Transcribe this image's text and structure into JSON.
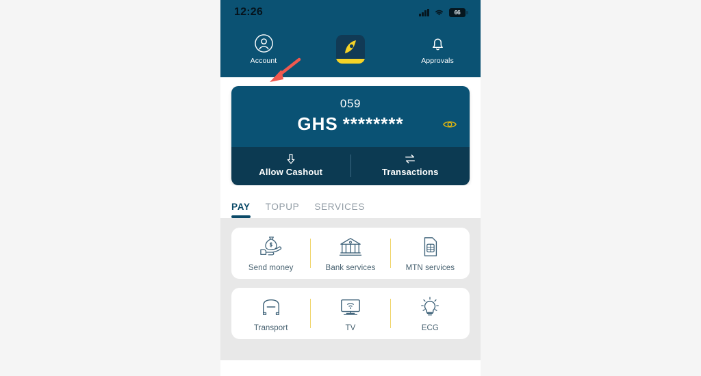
{
  "colors": {
    "header_bg": "#0b5273",
    "card_top": "#0a5274",
    "card_bottom": "#0c3a52",
    "accent_yellow": "#f5d327",
    "divider_yellow": "#f0d469",
    "active_tab": "#0b4a68",
    "inactive_tab": "#8f9aa3",
    "services_bg": "#e8e8e8",
    "annotation_arrow": "#f0594f",
    "page_bg": "#f5f5f5"
  },
  "statusbar": {
    "time": "12:26",
    "signal_icon": "cellular-signal-icon",
    "wifi_icon": "wifi-icon",
    "battery_level": "66",
    "battery_icon": "battery-icon"
  },
  "header": {
    "account": {
      "label": "Account",
      "icon": "user-circle-icon"
    },
    "logo": {
      "icon": "app-logo-icon"
    },
    "approvals": {
      "label": "Approvals",
      "icon": "bell-icon"
    }
  },
  "annotation": {
    "arrow_icon": "red-arrow-annotation",
    "points_at": "Account"
  },
  "balance_card": {
    "account_number": "059",
    "currency": "GHS",
    "masked_amount": "********",
    "toggle_visibility_icon": "eye-icon",
    "actions": [
      {
        "label": "Allow Cashout",
        "icon": "arrow-down-icon"
      },
      {
        "label": "Transactions",
        "icon": "transfer-arrows-icon"
      }
    ]
  },
  "tabs": [
    {
      "label": "PAY",
      "active": true
    },
    {
      "label": "TOPUP",
      "active": false
    },
    {
      "label": "SERVICES",
      "active": false
    }
  ],
  "service_rows": [
    {
      "items": [
        {
          "label": "Send money",
          "icon": "money-bag-hand-icon"
        },
        {
          "label": "Bank services",
          "icon": "bank-building-icon"
        },
        {
          "label": "MTN services",
          "icon": "sim-card-icon"
        }
      ]
    },
    {
      "items": [
        {
          "label": "Transport",
          "icon": "car-icon"
        },
        {
          "label": "TV",
          "icon": "smart-tv-icon"
        },
        {
          "label": "ECG",
          "icon": "light-bulb-icon"
        }
      ]
    }
  ]
}
